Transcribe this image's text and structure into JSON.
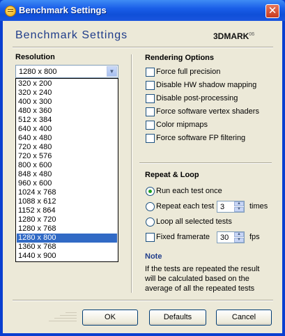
{
  "window": {
    "title": "Benchmark Settings",
    "close_label": "✕"
  },
  "header": {
    "title": "Benchmark Settings",
    "logo_text": "3DMARK",
    "logo_sup": "06"
  },
  "resolution": {
    "label": "Resolution",
    "selected": "1280 x 800",
    "options": [
      "320 x 200",
      "320 x 240",
      "400 x 300",
      "480 x 360",
      "512 x 384",
      "640 x 400",
      "640 x 480",
      "720 x 480",
      "720 x 576",
      "800 x 600",
      "848 x 480",
      "960 x 600",
      "1024 x 768",
      "1088 x 612",
      "1152 x 864",
      "1280 x 720",
      "1280 x 768",
      "1280 x 800",
      "1360 x 768",
      "1440 x 900"
    ],
    "selected_index": 17
  },
  "rendering": {
    "label": "Rendering Options",
    "options": [
      {
        "label": "Force full precision",
        "checked": false
      },
      {
        "label": "Disable HW shadow mapping",
        "checked": false
      },
      {
        "label": "Disable post-processing",
        "checked": false
      },
      {
        "label": "Force software vertex shaders",
        "checked": false
      },
      {
        "label": "Color mipmaps",
        "checked": false
      },
      {
        "label": "Force software FP filtering",
        "checked": false
      }
    ]
  },
  "repeat": {
    "label": "Repeat & Loop",
    "run_once": "Run each test once",
    "repeat_each": "Repeat each test",
    "repeat_count": "3",
    "times": "times",
    "loop_all": "Loop all selected tests",
    "fixed_framerate": "Fixed framerate",
    "fps_value": "30",
    "fps": "fps",
    "selected_mode": "run_once"
  },
  "note": {
    "title": "Note",
    "text": "If the tests are repeated the result will be calculated based on the average of all the repeated tests"
  },
  "buttons": {
    "ok": "OK",
    "defaults": "Defaults",
    "cancel": "Cancel"
  },
  "colors": {
    "title_bar": "#0f4fd8",
    "selection": "#316ac5",
    "dialog_bg": "#ece9d8",
    "header_text": "#1f3c8a"
  }
}
